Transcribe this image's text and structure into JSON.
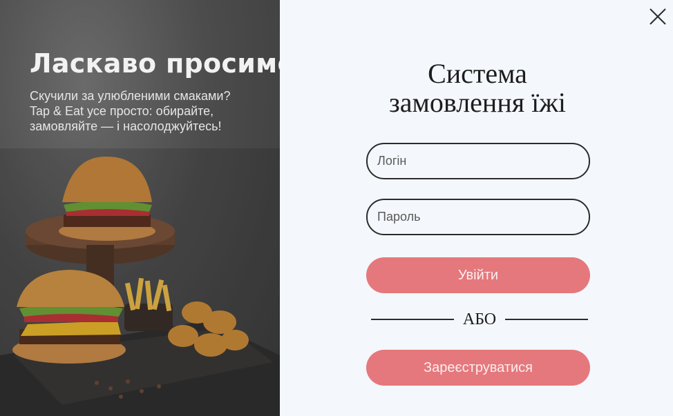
{
  "hero": {
    "title": "Ласкаво просимо!",
    "lines": [
      "Скучили за улюбленими смаками?",
      "Tap & Eat усе просто: обирайте,",
      "замовляйте — і насолоджуйтесь!"
    ]
  },
  "form": {
    "title_lines": [
      "Система",
      "замовлення їжі"
    ],
    "login_placeholder": "Логін",
    "password_placeholder": "Пароль",
    "login_button": "Увійти",
    "or_label": "АБО",
    "register_button": "Зареєструватися"
  },
  "colors": {
    "accent": "#e5787c",
    "background": "#f4f7fc",
    "hero_bg": "#4c4c4c"
  },
  "icons": {
    "close": "close-icon"
  }
}
